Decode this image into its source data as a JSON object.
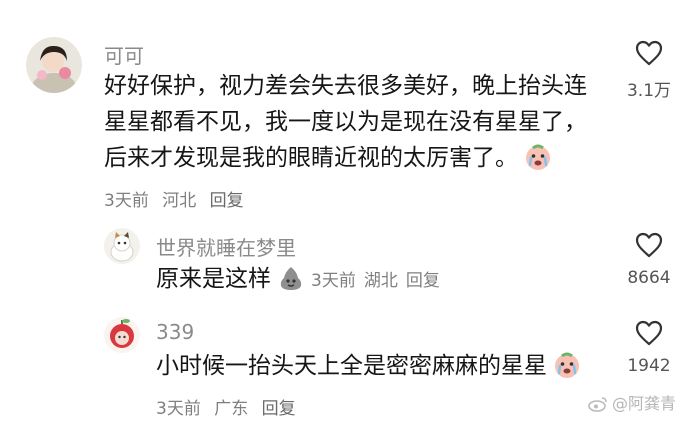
{
  "comments": [
    {
      "username": "可可",
      "lines": [
        "好好保护，视力差会失去很多美好，晚上抬头连",
        "星星都看不见，我一度以为是现在没有星星了，",
        "后来才发现是我的眼睛近视的太厉害了。"
      ],
      "time": "3天前",
      "location": "河北",
      "reply_label": "回复",
      "likes": "3.1万",
      "emoji_icon": "crying-peach-emoji"
    },
    {
      "username": "世界就睡在梦里",
      "text": "原来是这样",
      "time": "3天前",
      "location": "湖北",
      "reply_label": "回复",
      "likes": "8664",
      "emoji_icon": "gray-blob-emoji"
    },
    {
      "username": "339",
      "text": "小时候一抬头天上全是密密麻麻的星星",
      "time": "3天前",
      "location": "广东",
      "reply_label": "回复",
      "likes": "1942",
      "emoji_icon": "crying-peach-emoji"
    }
  ],
  "watermark": "@阿龚青",
  "colors": {
    "text": "#161616",
    "username": "#8a8a8a",
    "meta": "#7f7f7f",
    "like_icon": "#333333",
    "background": "#ffffff"
  }
}
